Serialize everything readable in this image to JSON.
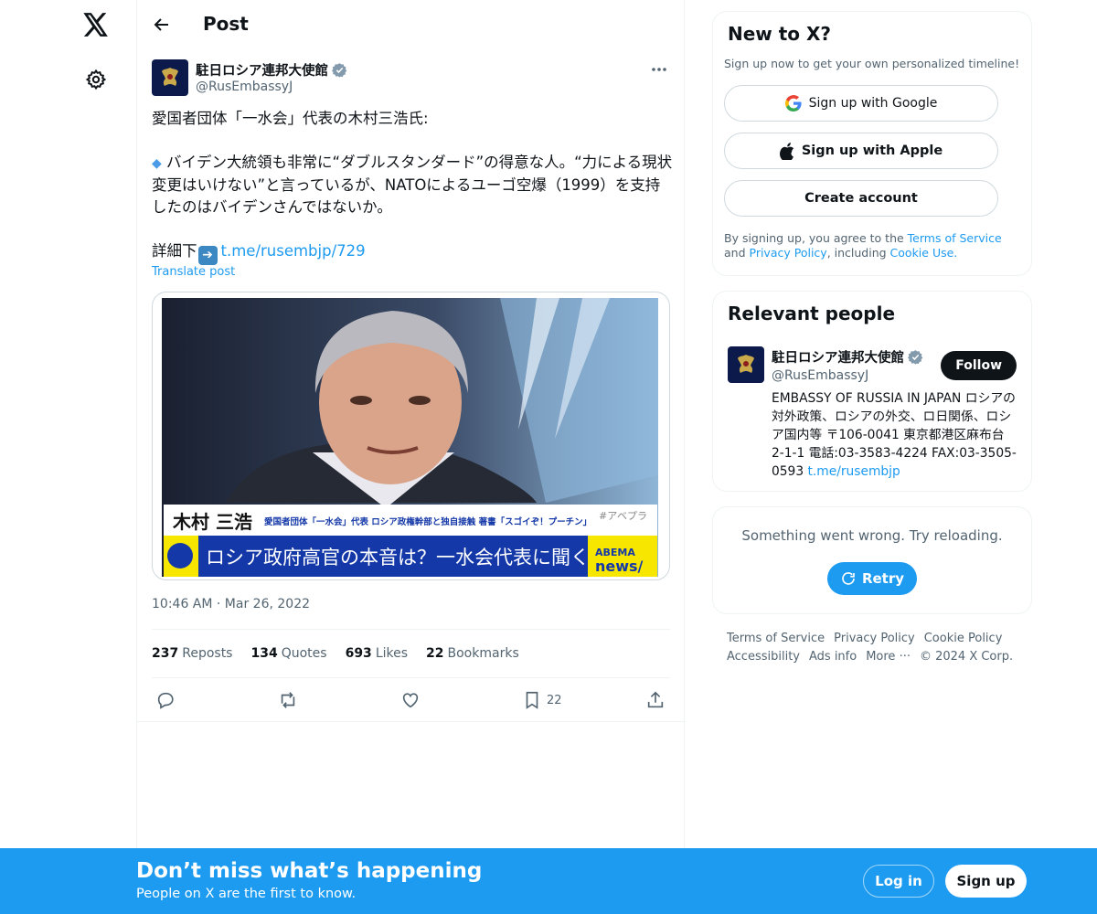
{
  "header": {
    "title": "Post"
  },
  "post": {
    "author_name": "駐日ロシア連邦大使館",
    "author_handle": "@RusEmbassyJ",
    "text_line1": "愛国者団体「一水会」代表の木村三浩氏:",
    "text_bullet": "バイデン大統領も非常に“ダブルスタンダード”の得意な人。“力による現状変更はいけない”と言っているが、NATOによるユーゴ空爆（1999）を支持したのはバイデンさんではないか。",
    "text_details": "詳細下",
    "link": "t.me/rusembjp/729",
    "translate": "Translate post",
    "timestamp": "10:46 AM · Mar 26, 2022",
    "media": {
      "name_caption": "木村 三浩",
      "sub_caption": "愛国者団体「一水会」代表 ロシア政権幹部と独自接触 著書「スゴイぞ！プーチン」",
      "headline": "ロシア政府高官の本音は？一水会代表に聞く",
      "watermark": "#アベプラ",
      "brand_top": "ABEMA",
      "brand_bottom": "news/"
    }
  },
  "stats": {
    "reposts_count": "237",
    "reposts_label": "Reposts",
    "quotes_count": "134",
    "quotes_label": "Quotes",
    "likes_count": "693",
    "likes_label": "Likes",
    "bookmarks_count": "22",
    "bookmarks_label": "Bookmarks"
  },
  "actions": {
    "bookmark_count": "22"
  },
  "signup_card": {
    "title": "New to X?",
    "subtitle": "Sign up now to get your own personalized timeline!",
    "google": "Sign up with Google",
    "apple": "Sign up with Apple",
    "create": "Create account",
    "legal_1": "By signing up, you agree to the ",
    "terms": "Terms of Service",
    "legal_2": " and ",
    "privacy": "Privacy Policy",
    "legal_3": ", including ",
    "cookie": "Cookie Use."
  },
  "relevant": {
    "title": "Relevant people",
    "name": "駐日ロシア連邦大使館",
    "handle": "@RusEmbassyJ",
    "follow": "Follow",
    "bio": "EMBASSY OF RUSSIA IN JAPAN ロシアの対外政策、ロシアの外交、ロ日関係、ロシア国内等 〒106-0041 東京都港区麻布台2-1-1 電話:03-3583-4224 FAX:03-3505-0593 ",
    "bio_link": "t.me/rusembjp"
  },
  "error_card": {
    "message": "Something went wrong. Try reloading.",
    "retry": "Retry"
  },
  "footer": {
    "terms": "Terms of Service",
    "privacy": "Privacy Policy",
    "cookie": "Cookie Policy",
    "accessibility": "Accessibility",
    "ads": "Ads info",
    "more": "More ···",
    "copyright": "© 2024 X Corp."
  },
  "bottom_bar": {
    "title": "Don’t miss what’s happening",
    "subtitle": "People on X are the first to know.",
    "login": "Log in",
    "signup": "Sign up"
  },
  "colors": {
    "accent": "#1d9bf0",
    "text": "#0f1419",
    "muted": "#536471",
    "border": "#eff3f4"
  }
}
